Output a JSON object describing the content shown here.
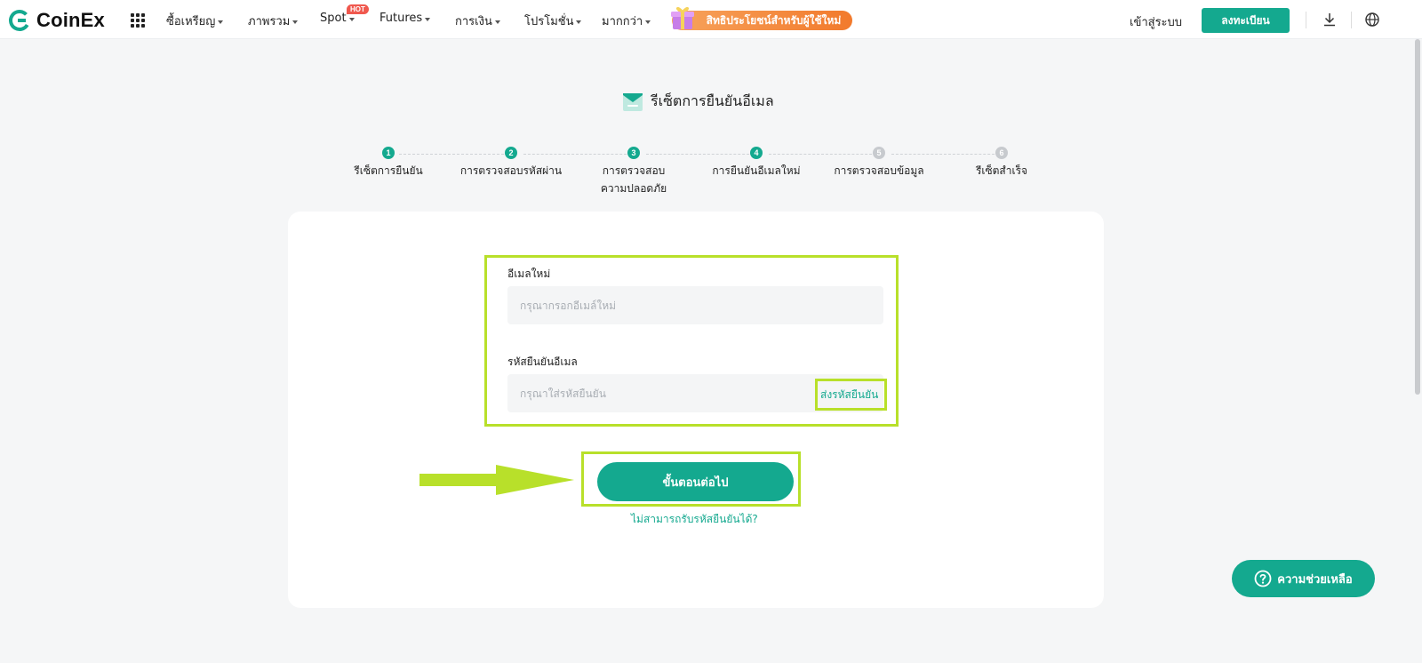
{
  "brand": {
    "name": "CoinEx",
    "color": "#14a98f"
  },
  "nav": {
    "items": [
      "ซื้อเหรียญ",
      "ภาพรวม",
      "Spot",
      "Futures",
      "การเงิน",
      "โปรโมชั่น",
      "มากกว่า"
    ],
    "hot_badge": "HOT",
    "promo": "สิทธิประโยชน์สำหรับผู้ใช้ใหม่",
    "login": "เข้าสู่ระบบ",
    "register": "ลงทะเบียน"
  },
  "page": {
    "title": "รีเซ็ตการยืนยันอีเมล"
  },
  "steps": [
    {
      "num": "1",
      "label": "รีเซ็ตการยืนยัน",
      "state": "done"
    },
    {
      "num": "2",
      "label": "การตรวจสอบรหัสผ่าน",
      "state": "done"
    },
    {
      "num": "3",
      "label": "การตรวจสอบความปลอดภัย",
      "state": "done"
    },
    {
      "num": "4",
      "label": "การยืนยันอีเมลใหม่",
      "state": "current"
    },
    {
      "num": "5",
      "label": "การตรวจสอบข้อมูล",
      "state": "pending"
    },
    {
      "num": "6",
      "label": "รีเซ็ตสำเร็จ",
      "state": "pending"
    }
  ],
  "form": {
    "email_label": "อีเมลใหม่",
    "email_placeholder": "กรุณากรอกอีเมล์ใหม่",
    "email_value": "",
    "code_label": "รหัสยืนยันอีเมล",
    "code_placeholder": "กรุณาใส่รหัสยืนยัน",
    "code_value": "",
    "send_code": "ส่งรหัสยืนยัน",
    "next": "ขั้นตอนต่อไป",
    "cant_receive": "ไม่สามารถรับรหัสยืนยันได้?"
  },
  "help": {
    "label": "ความช่วยเหลือ"
  },
  "annotation_color": "#b8e02a"
}
